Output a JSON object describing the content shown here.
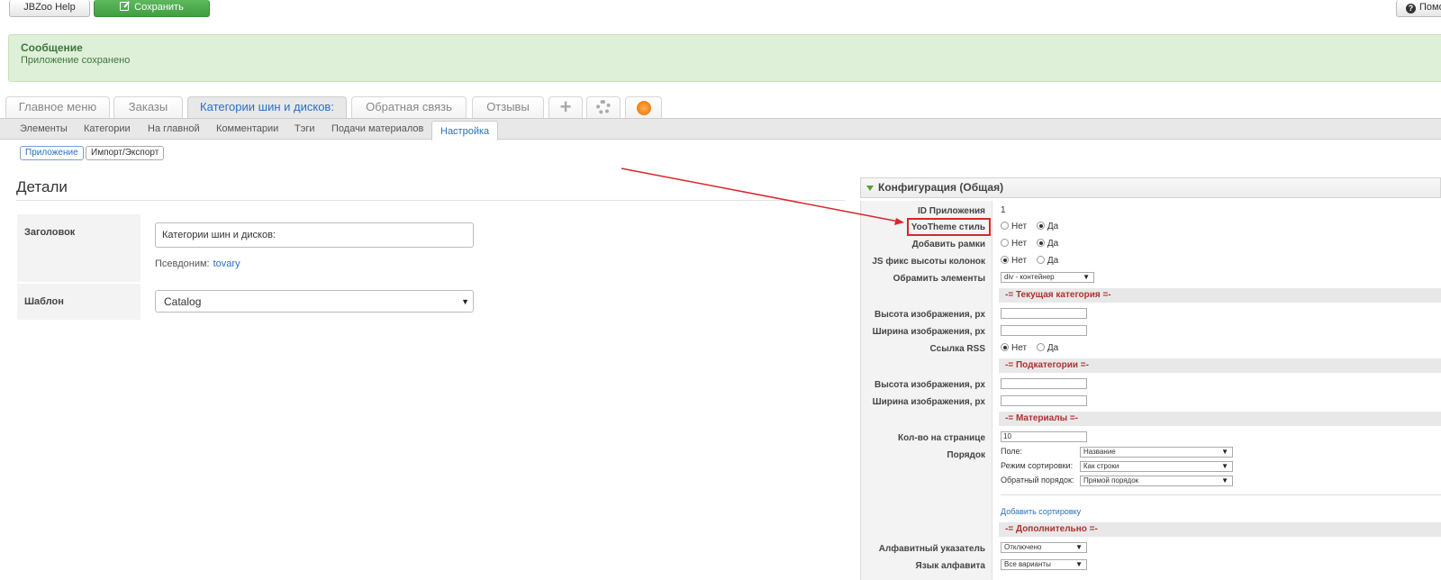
{
  "toolbar": {
    "help_label": "JBZoo Help",
    "save_label": "Сохранить",
    "right_label": "Помо"
  },
  "message": {
    "title": "Сообщение",
    "text": "Приложение сохранено"
  },
  "main_tabs": [
    {
      "label": "Главное меню"
    },
    {
      "label": "Заказы"
    },
    {
      "label": "Категории шин и дисков:"
    },
    {
      "label": "Обратная связь"
    },
    {
      "label": "Отзывы"
    }
  ],
  "sub_tabs": [
    {
      "label": "Элементы"
    },
    {
      "label": "Категории"
    },
    {
      "label": "На главной"
    },
    {
      "label": "Комментарии"
    },
    {
      "label": "Тэги"
    },
    {
      "label": "Подачи материалов"
    },
    {
      "label": "Настройка"
    }
  ],
  "pills": [
    {
      "label": "Приложение"
    },
    {
      "label": "Импорт/Экспорт"
    }
  ],
  "details": {
    "title": "Детали",
    "title_label": "Заголовок",
    "title_value": "Категории шин и дисков:",
    "alias_label": "Псевдоним:",
    "alias_value": "tovary",
    "template_label": "Шаблон",
    "template_value": "Catalog"
  },
  "config": {
    "header": "Конфигурация (Общая)",
    "app_id_label": "ID Приложения",
    "app_id_value": "1",
    "yootheme_label": "YooTheme стиль",
    "frames_label": "Добавить рамки",
    "jsfix_label": "JS фикс высоты колонок",
    "wrap_label": "Обрамить элементы",
    "wrap_value": "div - контейнер",
    "no": "Нет",
    "yes": "Да",
    "section_current": "-= Текущая категория =-",
    "img_height_label": "Высота изображения, px",
    "img_width_label": "Ширина изображения, px",
    "rss_label": "Ссылка RSS",
    "section_sub": "-= Подкатегории =-",
    "sub_img_height_label": "Высота изображения, px",
    "sub_img_width_label": "Ширина изображения, px",
    "section_items": "-= Материалы =-",
    "per_page_label": "Кол-во на странице",
    "per_page_value": "10",
    "order_label": "Порядок",
    "order_field_label": "Поле:",
    "order_field_value": "Название",
    "order_mode_label": "Режим сортировки:",
    "order_mode_value": "Как строки",
    "order_reverse_label": "Обратный порядок:",
    "order_reverse_value": "Прямой порядок",
    "add_sort_link": "Добавить сортировку",
    "section_extra": "-= Дополнительно =-",
    "alpha_label": "Алфавитный указатель",
    "alpha_value": "Отключено",
    "alpha_lang_label": "Язык алфавита",
    "alpha_lang_value": "Все варианты"
  },
  "colors": {
    "accent_blue": "#2a6fc2",
    "save_green": "#4aa94a",
    "message_bg": "#dff0d8",
    "annotation_red": "#d9262b"
  }
}
